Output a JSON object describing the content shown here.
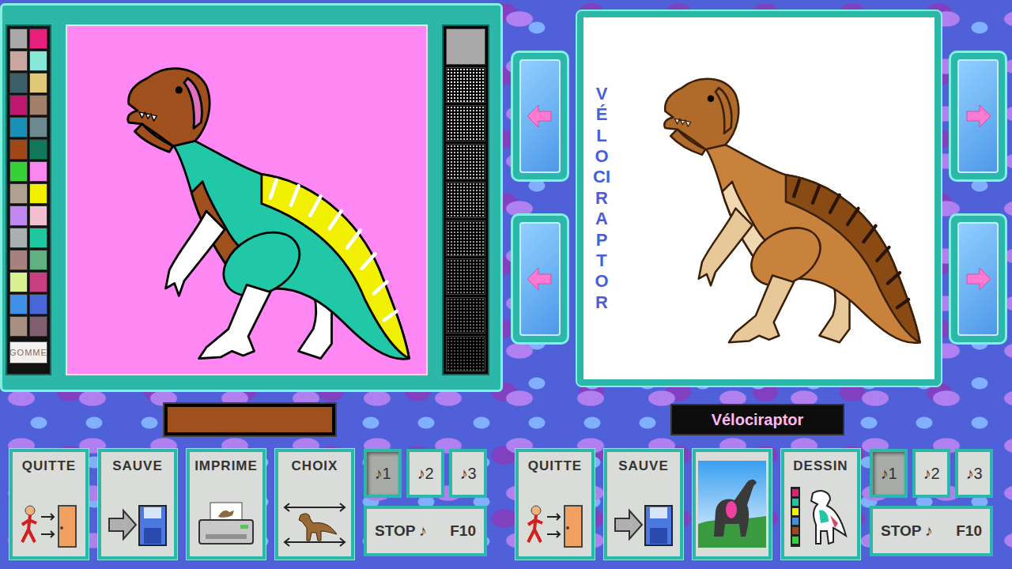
{
  "left_screen": {
    "palette": [
      {
        "color": "#a8a8a8"
      },
      {
        "color": "#e8207c"
      },
      {
        "color": "#c8a8a0"
      },
      {
        "color": "#88e8d8"
      },
      {
        "color": "#3c6068"
      },
      {
        "color": "#e0c878"
      },
      {
        "color": "#c01870"
      },
      {
        "color": "#a08068"
      },
      {
        "color": "#1890b8"
      },
      {
        "color": "#6c8890"
      },
      {
        "color": "#a04818"
      },
      {
        "color": "#107858"
      },
      {
        "color": "#38d038"
      },
      {
        "color": "#f888f0"
      },
      {
        "color": "#b0a090"
      },
      {
        "color": "#f0f000"
      },
      {
        "color": "#c088f0"
      },
      {
        "color": "#f0c0d0"
      },
      {
        "color": "#a8b0b0"
      },
      {
        "color": "#20c8a0"
      },
      {
        "color": "#a88080"
      },
      {
        "color": "#60b080"
      },
      {
        "color": "#d8f090"
      },
      {
        "color": "#c84080"
      },
      {
        "color": "#4090e8"
      },
      {
        "color": "#4868d8"
      },
      {
        "color": "#a89080"
      },
      {
        "color": "#806070"
      }
    ],
    "eraser": {
      "label": "GOMME"
    },
    "patterns": [
      {
        "kind": "solid",
        "color": "#a8a8a8"
      },
      {
        "kind": "dots",
        "color": "#e8e8e8"
      },
      {
        "kind": "dots",
        "color": "#d0d0d0"
      },
      {
        "kind": "dots",
        "color": "#c0c0c0"
      },
      {
        "kind": "dots",
        "color": "#b0b0b0"
      },
      {
        "kind": "dots",
        "color": "#989898"
      },
      {
        "kind": "dots",
        "color": "#808080"
      },
      {
        "kind": "dots",
        "color": "#686868"
      },
      {
        "kind": "dots",
        "color": "#505050"
      }
    ],
    "current_color": "#a0501c",
    "toolbar": [
      {
        "label": "QUITTE",
        "kind": "quit"
      },
      {
        "label": "SAUVE",
        "kind": "save"
      },
      {
        "label": "IMPRIME",
        "kind": "print"
      },
      {
        "label": "CHOIX",
        "kind": "choice"
      }
    ],
    "music": [
      {
        "label": "♪1",
        "selected": true
      },
      {
        "label": "♪2",
        "selected": false
      },
      {
        "label": "♪3",
        "selected": false
      }
    ],
    "stop": {
      "label": "STOP ♪",
      "key": "F10"
    }
  },
  "right_screen": {
    "vertical_title": "VÉLOCIRAPTOR",
    "name": "Vélociraptor",
    "toolbar": [
      {
        "label": "QUITTE",
        "kind": "quit"
      },
      {
        "label": "SAUVE",
        "kind": "save"
      },
      {
        "kind": "picture"
      },
      {
        "label": "DESSIN",
        "kind": "draw"
      }
    ],
    "music": [
      {
        "label": "♪1",
        "selected": true
      },
      {
        "label": "♪2",
        "selected": false
      },
      {
        "label": "♪3",
        "selected": false
      }
    ],
    "stop": {
      "label": "STOP ♪",
      "key": "F10"
    }
  }
}
